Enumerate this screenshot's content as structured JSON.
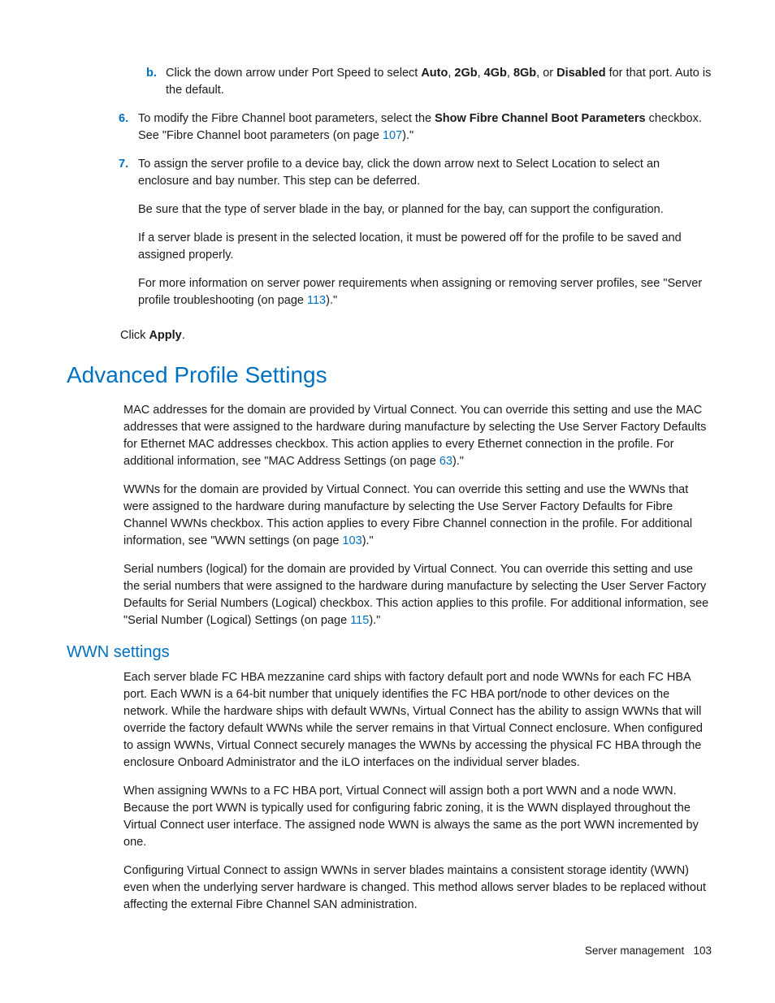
{
  "itemB": {
    "marker": "b.",
    "pre": "Click the down arrow under Port Speed to select ",
    "opt1": "Auto",
    "sep": ", ",
    "opt2": "2Gb",
    "opt3": "4Gb",
    "opt4": "8Gb",
    "sepOr": ", or ",
    "opt5": "Disabled",
    "post": " for that port. Auto is the default."
  },
  "item6": {
    "marker": "6.",
    "pre": "To modify the Fibre Channel boot parameters, select the ",
    "bold": "Show Fibre Channel Boot Parameters",
    "mid": " checkbox. See \"Fibre Channel boot parameters (on page ",
    "link": "107",
    "post": ").\""
  },
  "item7": {
    "marker": "7.",
    "p1": "To assign the server profile to a device bay, click the down arrow next to Select Location to select an enclosure and bay number. This step can be deferred.",
    "p2": "Be sure that the type of server blade in the bay, or planned for the bay, can support the configuration.",
    "p3": "If a server blade is present in the selected location, it must be powered off for the profile to be saved and assigned properly.",
    "p4_pre": "For more information on server power requirements when assigning or removing server profiles, see \"Server profile troubleshooting (on page ",
    "p4_link": "113",
    "p4_post": ").\""
  },
  "clickApply": {
    "pre": "Click ",
    "bold": "Apply",
    "post": "."
  },
  "h1": "Advanced Profile Settings",
  "aps": {
    "p1_pre": "MAC addresses for the domain are provided by Virtual Connect. You can override this setting and use the MAC addresses that were assigned to the hardware during manufacture by selecting the Use Server Factory Defaults for Ethernet MAC addresses checkbox. This action applies to every Ethernet connection in the profile. For additional information, see \"MAC Address Settings (on page ",
    "p1_link": "63",
    "p1_post": ").\"",
    "p2_pre": "WWNs for the domain are provided by Virtual Connect. You can override this setting and use the WWNs that were assigned to the hardware during manufacture by selecting the Use Server Factory Defaults for Fibre Channel WWNs checkbox. This action applies to every Fibre Channel connection in the profile. For additional information, see \"WWN settings (on page ",
    "p2_link": "103",
    "p2_post": ").\"",
    "p3_pre": "Serial numbers (logical) for the domain are provided by Virtual Connect. You can override this setting and use the serial numbers that were assigned to the hardware during manufacture by selecting the User Server Factory Defaults for Serial Numbers (Logical) checkbox. This action applies to this profile. For additional information, see \"Serial Number (Logical) Settings (on page ",
    "p3_link": "115",
    "p3_post": ").\""
  },
  "h2": "WWN settings",
  "wwn": {
    "p1": "Each server blade FC HBA mezzanine card ships with factory default port and node WWNs for each FC HBA port. Each WWN is a 64-bit number that uniquely identifies the FC HBA port/node to other devices on the network. While the hardware ships with default WWNs, Virtual Connect has the ability to assign WWNs that will override the factory default WWNs while the server remains in that Virtual Connect enclosure. When configured to assign WWNs, Virtual Connect securely manages the WWNs by accessing the physical FC HBA through the enclosure Onboard Administrator and the iLO interfaces on the individual server blades.",
    "p2": "When assigning WWNs to a FC HBA port, Virtual Connect will assign both a port WWN and a node WWN. Because the port WWN is typically used for configuring fabric zoning, it is the WWN displayed throughout the Virtual Connect user interface. The assigned node WWN is always the same as the port WWN incremented by one.",
    "p3": "Configuring Virtual Connect to assign WWNs in server blades maintains a consistent storage identity (WWN) even when the underlying server hardware is changed. This method allows server blades to be replaced without affecting the external Fibre Channel SAN administration."
  },
  "footer": {
    "label": "Server management",
    "page": "103"
  }
}
